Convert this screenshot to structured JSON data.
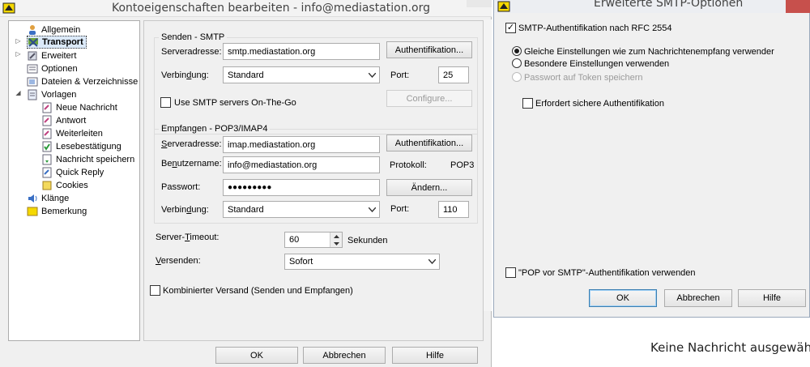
{
  "main_window": {
    "title": "Kontoeigenschaften bearbeiten - info@mediastation.org"
  },
  "tree": {
    "items": [
      {
        "label": "Allgemein",
        "level": 0,
        "icon": "person-icon"
      },
      {
        "label": "Transport",
        "level": 0,
        "icon": "network-icon",
        "selected": true
      },
      {
        "label": "Erweitert",
        "level": 0,
        "icon": "wrench-icon"
      },
      {
        "label": "Optionen",
        "level": 0,
        "icon": "options-icon"
      },
      {
        "label": "Dateien & Verzeichnisse",
        "level": 0,
        "icon": "folder-list-icon"
      },
      {
        "label": "Vorlagen",
        "level": 0,
        "icon": "template-icon"
      },
      {
        "label": "Neue Nachricht",
        "level": 1,
        "icon": "new-message-icon"
      },
      {
        "label": "Antwort",
        "level": 1,
        "icon": "reply-icon"
      },
      {
        "label": "Weiterleiten",
        "level": 1,
        "icon": "forward-icon"
      },
      {
        "label": "Lesebestätigung",
        "level": 1,
        "icon": "receipt-icon"
      },
      {
        "label": "Nachricht speichern",
        "level": 1,
        "icon": "save-message-icon"
      },
      {
        "label": "Quick Reply",
        "level": 1,
        "icon": "quick-reply-icon"
      },
      {
        "label": "Cookies",
        "level": 1,
        "icon": "cookies-icon"
      },
      {
        "label": "Klänge",
        "level": 0,
        "icon": "sound-icon"
      },
      {
        "label": "Bemerkung",
        "level": 0,
        "icon": "note-icon"
      }
    ]
  },
  "smtp": {
    "group_title": "Senden - SMTP",
    "server_label": "Serveradresse:",
    "server_value": "smtp.mediastation.org",
    "auth_button": "Authentifikation...",
    "connection_label": "Verbindung:",
    "connection_value": "Standard",
    "port_label": "Port:",
    "port_value": "25",
    "on_the_go_label": "Use SMTP servers On-The-Go",
    "configure_button": "Configure..."
  },
  "pop": {
    "group_title": "Empfangen - POP3/IMAP4",
    "server_label": "Serveradresse:",
    "server_value": "imap.mediastation.org",
    "auth_button": "Authentifikation...",
    "username_label": "Benutzername:",
    "username_value": "info@mediastation.org",
    "protocol_label": "Protokoll:",
    "protocol_value": "POP3",
    "password_label": "Passwort:",
    "password_value": "●●●●●●●●●",
    "change_button": "Ändern...",
    "connection_label": "Verbindung:",
    "connection_value": "Standard",
    "port_label": "Port:",
    "port_value": "110"
  },
  "general": {
    "timeout_label": "Server-Timeout:",
    "timeout_value": "60",
    "timeout_unit": "Sekunden",
    "send_label": "Versenden:",
    "send_value": "Sofort",
    "combined_label": "Kombinierter Versand (Senden und Empfangen)"
  },
  "main_buttons": {
    "ok": "OK",
    "cancel": "Abbrechen",
    "help": "Hilfe"
  },
  "smtp_dialog": {
    "title": "Erweiterte SMTP-Optionen",
    "rfc_label": "SMTP-Authentifikation nach RFC 2554",
    "radio_same": "Gleiche Einstellungen wie zum Nachrichtenempfang verwender",
    "radio_special": "Besondere Einstellungen verwenden",
    "radio_token": "Passwort auf Token speichern",
    "secure_label": "Erfordert sichere Authentifikation",
    "pop_before_label": "\"POP vor SMTP\"-Authentifikation verwenden",
    "ok": "OK",
    "cancel": "Abbrechen",
    "help": "Hilfe"
  },
  "background": {
    "status_text": "Keine Nachricht ausgewäh"
  },
  "colors": {
    "dialog_bg": "#f0f0f0",
    "title_bar": "#f3f3f3",
    "close_button": "#c7504c"
  }
}
